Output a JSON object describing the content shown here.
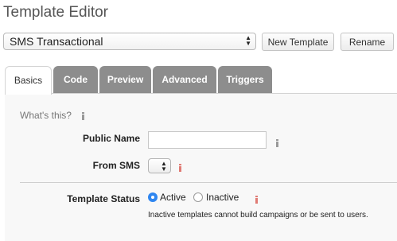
{
  "header": {
    "title": "Template Editor"
  },
  "template_select": {
    "value": "SMS Transactional"
  },
  "toolbar": {
    "new_label": "New Template",
    "rename_label": "Rename"
  },
  "tabs": [
    {
      "label": "Basics",
      "active": true
    },
    {
      "label": "Code",
      "active": false
    },
    {
      "label": "Preview",
      "active": false
    },
    {
      "label": "Advanced",
      "active": false
    },
    {
      "label": "Triggers",
      "active": false
    }
  ],
  "form": {
    "whats_this": "What's this?",
    "public_name_label": "Public Name",
    "public_name_value": "",
    "from_sms_label": "From SMS",
    "from_sms_value": "",
    "status_label": "Template Status",
    "status_options": [
      "Active",
      "Inactive"
    ],
    "status_selected": "Active",
    "status_note": "Inactive templates cannot build campaigns or be sent to users."
  },
  "icons": {
    "info": "info-icon",
    "info_required": "info-icon-red"
  },
  "colors": {
    "tab_inactive": "#8d8d8d",
    "radio_selected": "#2f86f0",
    "required_marker": "#e07b74"
  }
}
